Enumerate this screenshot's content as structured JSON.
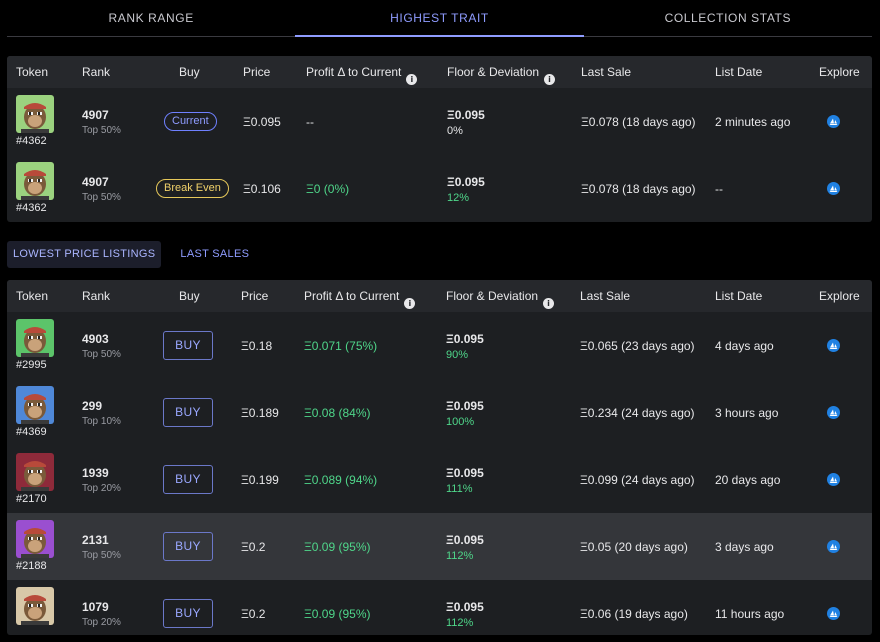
{
  "tabs": [
    {
      "label": "RANK RANGE",
      "active": false
    },
    {
      "label": "HIGHEST TRAIT",
      "active": true
    },
    {
      "label": "COLLECTION STATS",
      "active": false
    }
  ],
  "columns": {
    "token": "Token",
    "rank": "Rank",
    "buy": "Buy",
    "price": "Price",
    "profit": "Profit Δ to Current",
    "floor": "Floor & Deviation",
    "last_sale": "Last Sale",
    "list_date": "List Date",
    "explore": "Explore"
  },
  "colors": {
    "accent": "#8f9cff",
    "positive": "#4fd68a",
    "break_even": "#f0d16a",
    "panel": "#1d1f22",
    "header": "#26282c",
    "explore": "#2081e2"
  },
  "trait_rows": [
    {
      "token_id": "#4362",
      "rank": "4907",
      "rank_sub": "Top 50%",
      "buy_label": "Current",
      "buy_type": "current",
      "price": "Ξ0.095",
      "profit": "--",
      "profit_color": "neutral",
      "floor": "Ξ0.095",
      "deviation": "0%",
      "deviation_color": "neutral",
      "last_sale": "Ξ0.078 (18 days ago)",
      "list_date": "2 minutes ago",
      "avatar_bg": "#9bd27f"
    },
    {
      "token_id": "#4362",
      "rank": "4907",
      "rank_sub": "Top 50%",
      "buy_label": "Break Even",
      "buy_type": "even",
      "price": "Ξ0.106",
      "profit": "Ξ0 (0%)",
      "profit_color": "positive",
      "floor": "Ξ0.095",
      "deviation": "12%",
      "deviation_color": "positive",
      "last_sale": "Ξ0.078 (18 days ago)",
      "list_date": "--",
      "avatar_bg": "#9bd27f"
    }
  ],
  "subtabs": [
    {
      "label": "LOWEST PRICE LISTINGS",
      "active": true
    },
    {
      "label": "LAST SALES",
      "active": false
    }
  ],
  "listing_rows": [
    {
      "token_id": "#2995",
      "rank": "4903",
      "rank_sub": "Top 50%",
      "buy_label": "BUY",
      "price": "Ξ0.18",
      "profit": "Ξ0.071 (75%)",
      "floor": "Ξ0.095",
      "deviation": "90%",
      "last_sale": "Ξ0.065 (23 days ago)",
      "list_date": "4 days ago",
      "avatar_bg": "#5cc46a",
      "highlight": false
    },
    {
      "token_id": "#4369",
      "rank": "299",
      "rank_sub": "Top 10%",
      "buy_label": "BUY",
      "price": "Ξ0.189",
      "profit": "Ξ0.08 (84%)",
      "floor": "Ξ0.095",
      "deviation": "100%",
      "last_sale": "Ξ0.234 (24 days ago)",
      "list_date": "3 hours ago",
      "avatar_bg": "#4f88d8",
      "highlight": false
    },
    {
      "token_id": "#2170",
      "rank": "1939",
      "rank_sub": "Top 20%",
      "buy_label": "BUY",
      "price": "Ξ0.199",
      "profit": "Ξ0.089 (94%)",
      "floor": "Ξ0.095",
      "deviation": "111%",
      "last_sale": "Ξ0.099 (24 days ago)",
      "list_date": "20 days ago",
      "avatar_bg": "#8e2a3a",
      "highlight": false
    },
    {
      "token_id": "#2188",
      "rank": "2131",
      "rank_sub": "Top 50%",
      "buy_label": "BUY",
      "price": "Ξ0.2",
      "profit": "Ξ0.09 (95%)",
      "floor": "Ξ0.095",
      "deviation": "112%",
      "last_sale": "Ξ0.05 (20 days ago)",
      "list_date": "3 days ago",
      "avatar_bg": "#9a4fd0",
      "highlight": true
    },
    {
      "token_id": "",
      "rank": "1079",
      "rank_sub": "Top 20%",
      "buy_label": "BUY",
      "price": "Ξ0.2",
      "profit": "Ξ0.09 (95%)",
      "floor": "Ξ0.095",
      "deviation": "112%",
      "last_sale": "Ξ0.06 (19 days ago)",
      "list_date": "11 hours ago",
      "avatar_bg": "#d8c8a8",
      "highlight": false
    }
  ]
}
